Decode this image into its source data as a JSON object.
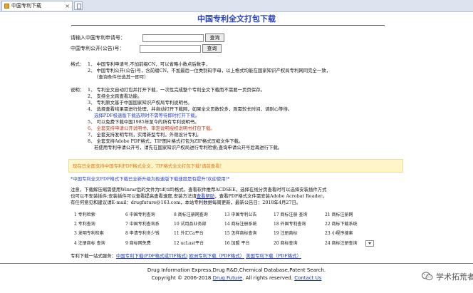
{
  "browser": {
    "tab_title": "中国专利下载",
    "close_glyph": "×"
  },
  "page": {
    "title": "中国专利全文打包下载"
  },
  "form": {
    "app_label": "请输入中国专利申请号：",
    "app_value": "",
    "pub_label": "中国专利公开(公告)号：",
    "pub_value": "",
    "search_btn": "查询"
  },
  "format_section": {
    "label": "格式：",
    "lines": [
      "1、 中国专利申请号,不加前缀CN，可以省略小数点后数字，",
      "2、 中国专利公开(公告)号，含前缀CN，不加最后一位类别码字母，以上格式均能在国家知识产权局专利网同完全一致，",
      "（查询条件任选其一即可）"
    ]
  },
  "notes_section": {
    "label": "说明：",
    "lines": [
      "1、 专利全文自动打包并打开下载，一次性完成整个专利全文下载而不需要一页页保存。",
      "2、 支持全文跨查看功能。",
      "3、 专利原文基于中国国家知识产权局专利说明书。",
      "4、 选择查看结果需进行处理，并自动打开下载网，如果全文页数较多，则需较长时间，请耐心等待。",
      "选择PDF极速版下载选项时不需等待即时打开下载。",
      "5、 可以免费下载中国1985年至今的所有专利说明书。",
      "6、 全套支持申请公开说明书，审定说明授权说明书打包下载。",
      "7、 全套支持发明专利，实用新型专利，外观设计专利。",
      "8、 全套支持Adobe PDF格式，TIF图片格式打包为ZIP格式压缩文件下载。",
      "若使用专利申请公开号，请先在国家知识产权局进行专利检索;查询申请公开号后再进行下载。"
    ],
    "cnipa_link": "国家知识产权局"
  },
  "notice": "现在已全面支持中国专利PDF格式全文，TIF格式全文打包下载!请前查看!",
  "format_note": "*中国专利全文PDF格式下载已全新升级为极速版下载速度是有提升!欢迎使用!*",
  "instructions": {
    "l1": "注意，下载解压缩需使用Winrar后的文件为tif(tiff)格式，查看软件推荐ACDSEE，选择在线分页查看时可以选择安装插件方式",
    "l2a": "也可以不安装插件;安装插件可以查看提高查看速度,安装方法请",
    "l2_link": "查看帮助",
    "l2b": "，查看PDF格式文件需安装Adobe Acrobat Reader。",
    "l3": "有任何意见和建议请E-mail：drugfuture@163.com，本站专利数据每周更新，最新公告日：2018年4月27日。"
  },
  "directory": [
    [
      "1 专利检索",
      "6 中国专利查询",
      "8 商标注册网查询",
      "13 中国专利公告",
      "17 商标注册 查询",
      "21 商标注册网"
    ],
    [
      "2 专利查询",
      "7 中国专利查询系",
      "10 试用品业务部",
      "14 商标注册系统",
      "18 外国专利查询",
      "22 商标下载系统"
    ],
    [
      "3 发明专利检索",
      "8 申请专利多少钱",
      "11 外汇Ca平台",
      "15 怎样商标查询",
      "19 注册商标",
      "23 小程序搜索"
    ],
    [
      "4 注册商标 查询",
      "9 商标网免费",
      "12 ucLust平台",
      "16 加盟 平台",
      "20 商标查询",
      "24 商标注册查询"
    ]
  ],
  "one_stop": {
    "label": "专利下载一站式服务：",
    "link1": "中国专利下载(PDF格式或TIF格式)",
    "link2": "欧洲专利下载（PDF格式）",
    "link3": "美国专利下载（PDF格式）"
  },
  "footer": {
    "line1": "Drug Information Express,Drug R&D,Chemical Database,Patent Search.",
    "line2_a": "Copyright © 2006-2018",
    "line2_link1": "Drug Future",
    "line2_b": ". All rights reserved.",
    "line2_link2": "Contact Us"
  },
  "watermark": {
    "text": "学术拓荒者",
    "icon": "wechat-icon"
  }
}
